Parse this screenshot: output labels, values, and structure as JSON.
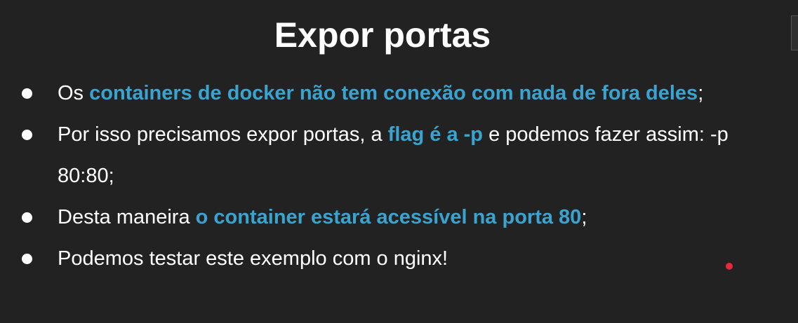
{
  "slide": {
    "title": "Expor portas",
    "bullets": [
      {
        "parts": [
          {
            "text": "Os ",
            "hl": false
          },
          {
            "text": "containers de docker não tem conexão com nada de fora deles",
            "hl": true
          },
          {
            "text": ";",
            "hl": false
          }
        ]
      },
      {
        "parts": [
          {
            "text": "Por isso precisamos expor portas, a ",
            "hl": false
          },
          {
            "text": "flag é a -p",
            "hl": true
          },
          {
            "text": " e podemos fazer assim: -p 80:80;",
            "hl": false
          }
        ]
      },
      {
        "parts": [
          {
            "text": "Desta maneira ",
            "hl": false
          },
          {
            "text": "o container estará acessível na porta 80",
            "hl": true
          },
          {
            "text": ";",
            "hl": false
          }
        ]
      },
      {
        "parts": [
          {
            "text": "Podemos testar este exemplo com o nginx!",
            "hl": false
          }
        ]
      }
    ]
  },
  "colors": {
    "background": "#222222",
    "text": "#ffffff",
    "highlight": "#3aa3cf",
    "pointer": "#e8283c"
  }
}
